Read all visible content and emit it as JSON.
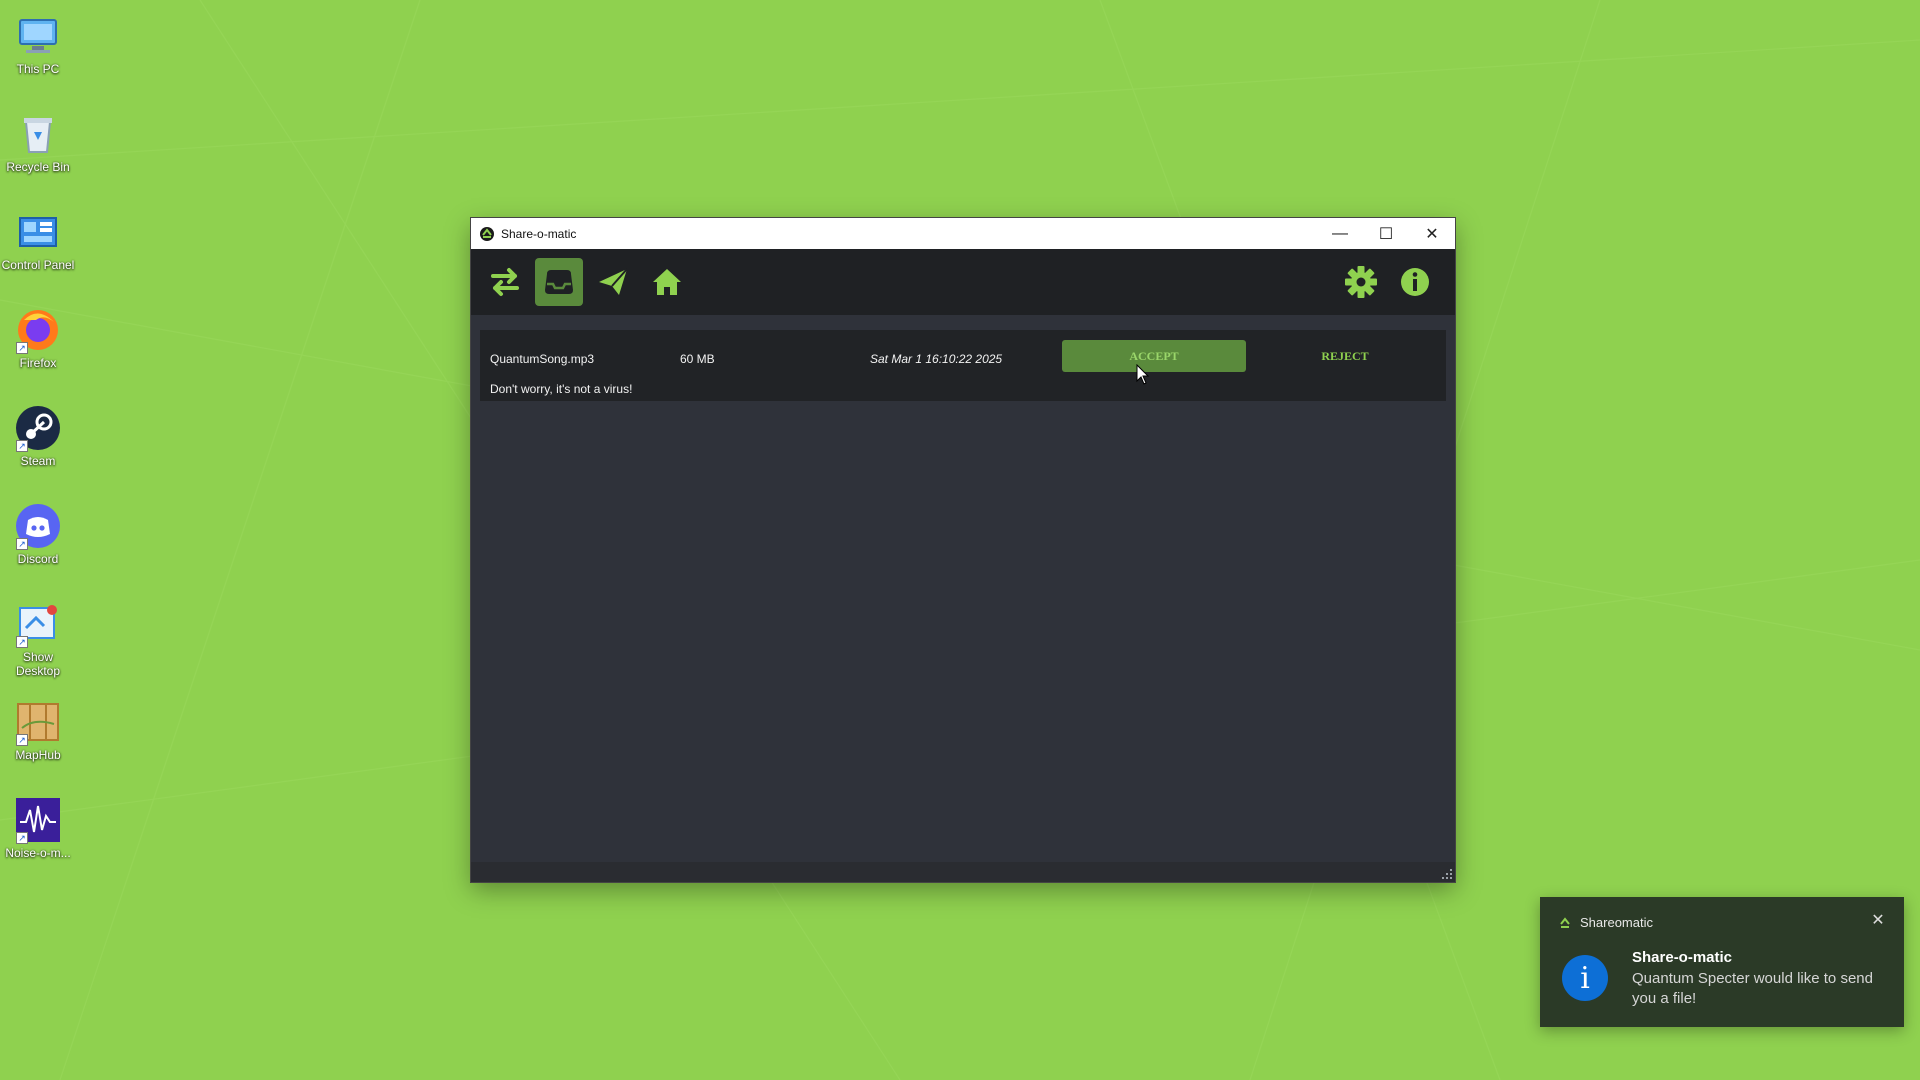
{
  "desktop": {
    "icons": [
      {
        "label": "This PC",
        "icon": "computer-icon"
      },
      {
        "label": "Recycle Bin",
        "icon": "recycle-bin-icon"
      },
      {
        "label": "Control Panel",
        "icon": "control-panel-icon"
      },
      {
        "label": "Firefox",
        "icon": "firefox-icon"
      },
      {
        "label": "Steam",
        "icon": "steam-icon"
      },
      {
        "label": "Discord",
        "icon": "discord-icon"
      },
      {
        "label": "Show Desktop",
        "icon": "show-desktop-icon"
      },
      {
        "label": "MapHub",
        "icon": "map-icon"
      },
      {
        "label": "Noise-o-m...",
        "icon": "audio-wave-icon"
      }
    ]
  },
  "window": {
    "title": "Share-o-matic",
    "controls": {
      "minimize": "—",
      "maximize": "☐",
      "close": "✕"
    },
    "toolbar": {
      "tabs": [
        {
          "icon": "transfer-arrows-icon",
          "active": false
        },
        {
          "icon": "inbox-icon",
          "active": true
        },
        {
          "icon": "send-plane-icon",
          "active": false
        },
        {
          "icon": "home-icon",
          "active": false
        }
      ],
      "right": [
        {
          "icon": "gear-icon"
        },
        {
          "icon": "info-icon"
        }
      ],
      "accent": "#8fd14f"
    },
    "transfer": {
      "filename": "QuantumSong.mp3",
      "size": "60 MB",
      "date": "Sat Mar 1 16:10:22 2025",
      "message": "Don't worry, it's not a virus!",
      "accept_label": "ACCEPT",
      "reject_label": "REJECT"
    }
  },
  "toast": {
    "app": "Shareomatic",
    "title": "Share-o-matic",
    "message": "Quantum Specter would like to send you a file!",
    "icon": "info-icon",
    "close": "✕"
  }
}
